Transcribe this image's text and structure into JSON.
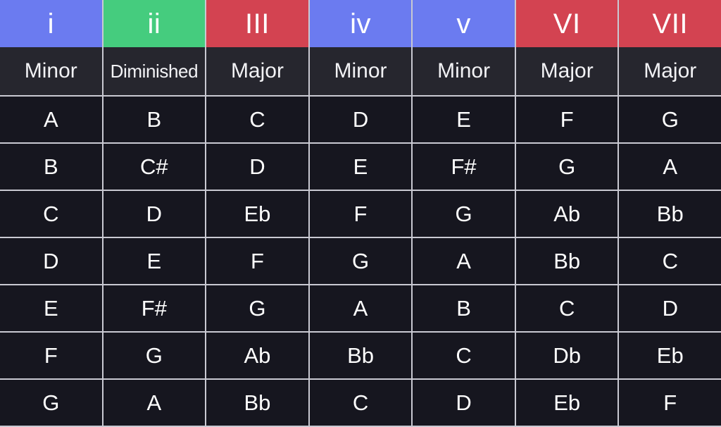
{
  "table": {
    "columns": [
      {
        "numeral": "i",
        "quality": "Minor",
        "color": "#6b7bf0"
      },
      {
        "numeral": "ii",
        "quality": "Diminished",
        "color": "#45cc7e"
      },
      {
        "numeral": "III",
        "quality": "Major",
        "color": "#d34351"
      },
      {
        "numeral": "iv",
        "quality": "Minor",
        "color": "#6b7bf0"
      },
      {
        "numeral": "v",
        "quality": "Minor",
        "color": "#6b7bf0"
      },
      {
        "numeral": "VI",
        "quality": "Major",
        "color": "#d34351"
      },
      {
        "numeral": "VII",
        "quality": "Major",
        "color": "#d34351"
      }
    ],
    "rows": [
      [
        "A",
        "B",
        "C",
        "D",
        "E",
        "F",
        "G"
      ],
      [
        "B",
        "C#",
        "D",
        "E",
        "F#",
        "G",
        "A"
      ],
      [
        "C",
        "D",
        "Eb",
        "F",
        "G",
        "Ab",
        "Bb"
      ],
      [
        "D",
        "E",
        "F",
        "G",
        "A",
        "Bb",
        "C"
      ],
      [
        "E",
        "F#",
        "G",
        "A",
        "B",
        "C",
        "D"
      ],
      [
        "F",
        "G",
        "Ab",
        "Bb",
        "C",
        "Db",
        "Eb"
      ],
      [
        "G",
        "A",
        "Bb",
        "C",
        "D",
        "Eb",
        "F"
      ]
    ]
  },
  "theme": {
    "page_background": "#0b0b10",
    "cell_background": "#16161f",
    "quality_background": "#26262e",
    "grid_line": "#c9c9d2",
    "text": "#ffffff"
  }
}
